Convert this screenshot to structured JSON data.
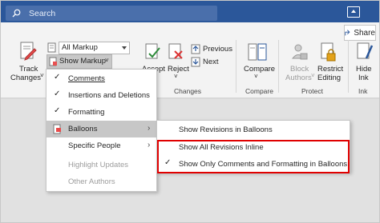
{
  "titlebar": {
    "search_placeholder": "Search"
  },
  "ribbon": {
    "share_label": "Share",
    "track_changes_line1": "Track",
    "track_changes_line2": "Changes",
    "markup_dropdown_value": "All Markup",
    "show_markup_label": "Show Markup",
    "accept_label": "Accept",
    "reject_label": "Reject",
    "previous_label": "Previous",
    "next_label": "Next",
    "compare_label": "Compare",
    "block_authors_line1": "Block",
    "block_authors_line2": "Authors",
    "restrict_editing_line1": "Restrict",
    "restrict_editing_line2": "Editing",
    "hide_ink_line1": "Hide",
    "hide_ink_line2": "Ink",
    "groups": {
      "changes": "Changes",
      "compare": "Compare",
      "protect": "Protect",
      "ink": "Ink"
    }
  },
  "show_markup_menu": {
    "items": [
      {
        "label": "Comments",
        "checked": true
      },
      {
        "label": "Insertions and Deletions",
        "checked": true
      },
      {
        "label": "Formatting",
        "checked": true
      },
      {
        "label": "Balloons",
        "checked": false,
        "submenu": true,
        "highlighted": true
      },
      {
        "label": "Specific People",
        "checked": false,
        "submenu": true
      },
      {
        "label": "Highlight Updates",
        "checked": false,
        "disabled": true
      },
      {
        "label": "Other Authors",
        "checked": false,
        "disabled": true
      }
    ]
  },
  "balloons_submenu": {
    "items": [
      {
        "label": "Show Revisions in Balloons",
        "checked": false
      },
      {
        "label": "Show All Revisions Inline",
        "checked": false
      },
      {
        "label": "Show Only Comments and Formatting in Balloons",
        "checked": true
      }
    ]
  },
  "colors": {
    "titlebar": "#2b579a",
    "highlight_box": "#e00000",
    "menu_hover": "#c7c7c7"
  }
}
